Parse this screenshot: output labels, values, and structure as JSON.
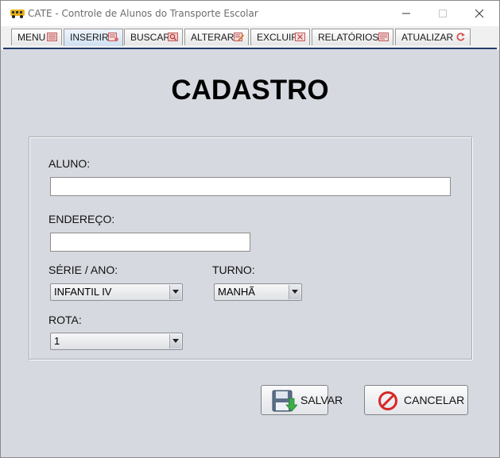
{
  "window": {
    "title": "CATE - Controle de Alunos do Transporte Escolar"
  },
  "tabs": [
    {
      "label": "MENU",
      "icon": "menu-icon"
    },
    {
      "label": "INSERIR",
      "icon": "insert-icon"
    },
    {
      "label": "BUSCAR",
      "icon": "search-icon"
    },
    {
      "label": "ALTERAR",
      "icon": "edit-icon"
    },
    {
      "label": "EXCLUIR",
      "icon": "delete-icon"
    },
    {
      "label": "RELATÓRIOS",
      "icon": "report-icon"
    },
    {
      "label": "ATUALIZAR",
      "icon": "refresh-icon"
    }
  ],
  "active_tab": "INSERIR",
  "form": {
    "title": "CADASTRO",
    "aluno": {
      "label": "ALUNO:",
      "value": ""
    },
    "endereco": {
      "label": "ENDEREÇO:",
      "value": ""
    },
    "serie": {
      "label": "SÉRIE / ANO:",
      "selected": "INFANTIL IV"
    },
    "turno": {
      "label": "TURNO:",
      "selected": "MANHÃ"
    },
    "rota": {
      "label": "ROTA:",
      "selected": "1"
    }
  },
  "buttons": {
    "save_label": "SALVAR",
    "cancel_label": "CANCELAR"
  },
  "colors": {
    "background": "#d6d9df",
    "tab_active": "#cfe0f2",
    "tab_underline": "#243b6b",
    "save_icon_green": "#3fae49",
    "cancel_icon_red": "#d62828"
  }
}
